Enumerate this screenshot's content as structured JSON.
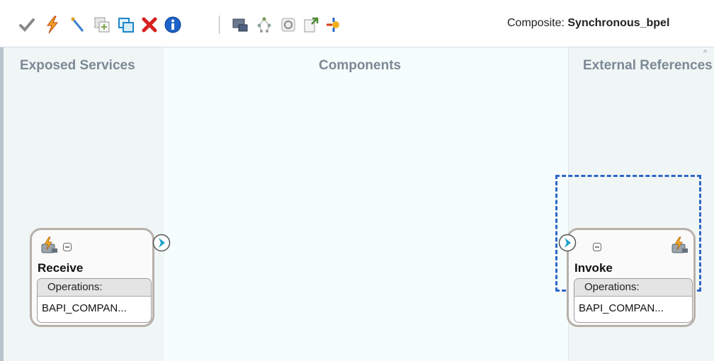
{
  "toolbar": {
    "icons": [
      "checkmark-icon",
      "lightning-icon",
      "wand-icon",
      "add-component-icon",
      "copy-component-icon",
      "delete-icon",
      "info-icon",
      "service-adapter-icon",
      "network-icon",
      "refresh-icon",
      "publish-icon",
      "wire-icon"
    ],
    "composite_label": "Composite:",
    "composite_name": "Synchronous_bpel"
  },
  "lanes": {
    "exposed": "Exposed Services",
    "components": "Components",
    "external": "External References"
  },
  "receive_card": {
    "title": "Receive",
    "operations_label": "Operations:",
    "operation": "BAPI_COMPAN..."
  },
  "invoke_card": {
    "title": "Invoke",
    "operations_label": "Operations:",
    "operation": "BAPI_COMPAN..."
  },
  "colors": {
    "selection": "#2f66c7",
    "chevron": "#1aa0c7",
    "lane_bg": "#f0f6f6"
  }
}
